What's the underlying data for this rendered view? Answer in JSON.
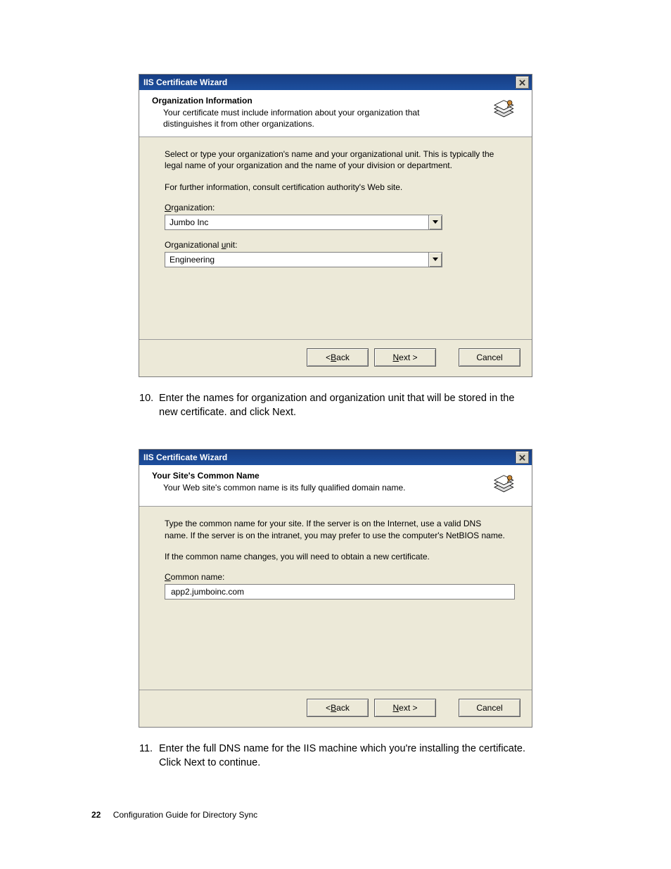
{
  "dialog1": {
    "title": "IIS Certificate Wizard",
    "header_title": "Organization Information",
    "header_sub": "Your certificate must include information about your organization that distinguishes it from other organizations.",
    "body_para1": "Select or type your organization's name and your organizational unit. This is typically the legal name of your organization and the name of your division or department.",
    "body_para2": "For further information, consult certification authority's Web site.",
    "org_label_char": "O",
    "org_label_rest": "rganization:",
    "org_value": "Jumbo Inc",
    "ou_label_pre": "Organizational ",
    "ou_label_char": "u",
    "ou_label_post": "nit:",
    "ou_value": "Engineering",
    "back_pre": "< ",
    "back_char": "B",
    "back_post": "ack",
    "next_char": "N",
    "next_post": "ext >",
    "cancel": "Cancel"
  },
  "step10": {
    "num": "10.",
    "text": "Enter the names for organization and organization unit that will be stored in the new certificate. and click Next."
  },
  "dialog2": {
    "title": "IIS Certificate Wizard",
    "header_title": "Your Site's Common Name",
    "header_sub": "Your Web site's common name is its fully qualified domain name.",
    "body_para1": "Type the common name for your site. If the server is on the Internet, use a valid DNS name. If the server is on the intranet, you may prefer to use the computer's NetBIOS name.",
    "body_para2": "If the common name changes, you will need to obtain a new certificate.",
    "cn_label_char": "C",
    "cn_label_rest": "ommon name:",
    "cn_value": "app2.jumboinc.com",
    "back_pre": "< ",
    "back_char": "B",
    "back_post": "ack",
    "next_char": "N",
    "next_post": "ext >",
    "cancel": "Cancel"
  },
  "step11": {
    "num": "11.",
    "text": "Enter the full DNS name for the IIS machine which you're installing the certificate. Click Next to continue."
  },
  "footer": {
    "page_num": "22",
    "doc_title": "Configuration Guide for Directory Sync"
  }
}
